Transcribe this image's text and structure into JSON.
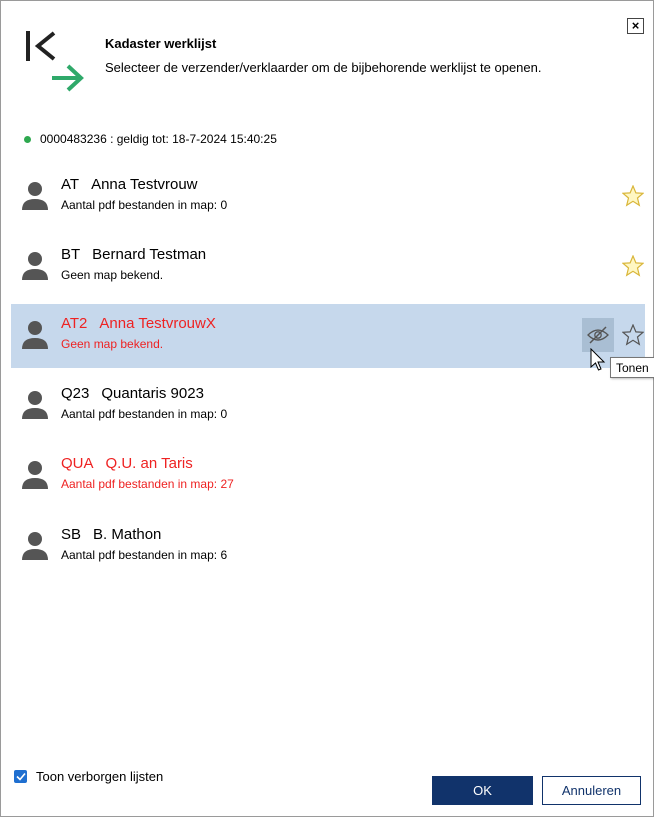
{
  "dialog": {
    "close_label": "×",
    "title": "Kadaster werklijst",
    "subtitle": "Selecteer de verzender/verklaarder om de bijbehorende werklijst te openen."
  },
  "status": {
    "text": "0000483236  : geldig tot: 18-7-2024 15:40:25",
    "color": "#2ea84f"
  },
  "items": [
    {
      "code": "AT",
      "name": "Anna Testvrouw",
      "info": "Aantal pdf bestanden in map: 0",
      "color": "#000000",
      "favorite_icon": "star-icon"
    },
    {
      "code": "BT",
      "name": "Bernard Testman",
      "info": "Geen map bekend.",
      "color": "#000000",
      "favorite_icon": "star-icon"
    },
    {
      "code": "AT2",
      "name": "Anna TestvrouwX",
      "info": "Geen map bekend.",
      "color": "#ee2222",
      "selected": true,
      "hidden_icon": "eye-slash-icon",
      "favorite_icon": "star-outline-icon"
    },
    {
      "code": "Q23",
      "name": "Quantaris 9023",
      "info": "Aantal pdf bestanden in map: 0",
      "color": "#000000"
    },
    {
      "code": "QUA",
      "name": "Q.U. an Taris",
      "info": "Aantal pdf bestanden in map: 27",
      "color": "#ee2222"
    },
    {
      "code": "SB",
      "name": "B. Mathon",
      "info": "Aantal pdf bestanden in map: 6",
      "color": "#000000"
    }
  ],
  "tooltip": "Tonen",
  "footer": {
    "show_hidden_label": "Toon verborgen lijsten",
    "show_hidden_checked": true,
    "ok_label": "OK",
    "cancel_label": "Annuleren"
  },
  "colors": {
    "selection": "#c6d8ec",
    "primary_button": "#11336b",
    "logo_arrow": "#2fa96a"
  }
}
